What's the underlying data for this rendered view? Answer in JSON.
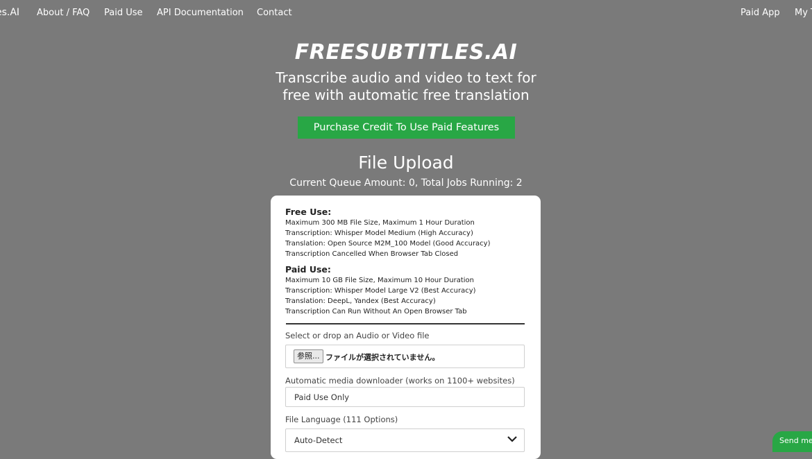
{
  "nav": {
    "brand": "es.AI",
    "links": [
      "About / FAQ",
      "Paid Use",
      "API Documentation",
      "Contact"
    ],
    "right_links": [
      "Paid App",
      "My T"
    ]
  },
  "hero": {
    "title": "FREESUBTITLES.AI",
    "subtitle_line1": "Transcribe audio and video to text for",
    "subtitle_line2": "free with automatic free translation",
    "purchase_button": "Purchase Credit To Use Paid Features"
  },
  "upload": {
    "title": "File Upload",
    "queue_status": "Current Queue Amount: 0, Total Jobs Running: 2"
  },
  "card": {
    "free": {
      "heading": "Free Use:",
      "lines": [
        "Maximum 300 MB File Size, Maximum 1 Hour Duration",
        "Transcription: Whisper Model Medium (High Accuracy)",
        "Translation: Open Source M2M_100 Model (Good Accuracy)",
        "Transcription Cancelled When Browser Tab Closed"
      ]
    },
    "paid": {
      "heading": "Paid Use:",
      "lines": [
        "Maximum 10 GB File Size, Maximum 10 Hour Duration",
        "Transcription: Whisper Model Large V2 (Best Accuracy)",
        "Translation: DeepL, Yandex (Best Accuracy)",
        "Transcription Can Run Without An Open Browser Tab"
      ]
    },
    "file_field": {
      "label": "Select or drop an Audio or Video file",
      "browse_button": "参照...",
      "status": "ファイルが選択されていません。"
    },
    "downloader_field": {
      "label": "Automatic media downloader (works on 1100+ websites)",
      "value": "Paid Use Only"
    },
    "language_field": {
      "label": "File Language (111 Options)",
      "selected": "Auto-Detect"
    }
  },
  "chat": {
    "label": "Send mes"
  },
  "colors": {
    "background": "#7a7a7a",
    "accent_green": "#28a745",
    "card": "#ffffff"
  }
}
